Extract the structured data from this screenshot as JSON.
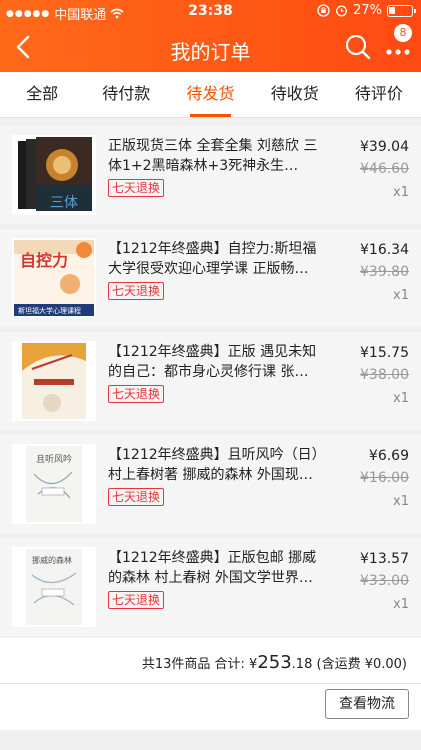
{
  "status_bar": {
    "carrier": "中国联通",
    "time": "23:38",
    "battery": "27%"
  },
  "header": {
    "title": "我的订单",
    "badge_count": "8"
  },
  "tabs": [
    {
      "label": "全部",
      "active": false
    },
    {
      "label": "待付款",
      "active": false
    },
    {
      "label": "待发货",
      "active": true
    },
    {
      "label": "待收货",
      "active": false
    },
    {
      "label": "待评价",
      "active": false
    }
  ],
  "items": [
    {
      "title": "正版现货三体 全套全集 刘慈欣 三体1+2黑暗森林+3死神永生…",
      "tag": "七天退换",
      "price": "¥39.04",
      "original_price": "¥46.60",
      "qty": "x1",
      "cover": "santi-cover"
    },
    {
      "title": "【1212年终盛典】自控力:斯坦福大学很受欢迎心理学课 正版畅…",
      "tag": "七天退换",
      "price": "¥16.34",
      "original_price": "¥39.80",
      "qty": "x1",
      "cover": "zikongli-cover",
      "cover_text": "自控力",
      "cover_subtext": "斯坦福大学心理课程"
    },
    {
      "title": "【1212年终盛典】正版 遇见未知的自己：都市身心灵修行课 张…",
      "tag": "七天退换",
      "price": "¥15.75",
      "original_price": "¥38.00",
      "qty": "x1",
      "cover": "yujian-cover"
    },
    {
      "title": "【1212年终盛典】且听风吟（日）村上春树著 挪威的森林 外国现…",
      "tag": "七天退换",
      "price": "¥6.69",
      "original_price": "¥16.00",
      "qty": "x1",
      "cover": "qietingfengyin-cover",
      "cover_text": "且听风吟"
    },
    {
      "title": "【1212年终盛典】正版包邮 挪威的森林 村上春树 外国文学世界…",
      "tag": "七天退换",
      "price": "¥13.57",
      "original_price": "¥33.00",
      "qty": "x1",
      "cover": "nuowei-cover",
      "cover_text": "挪威的森林"
    }
  ],
  "summary": {
    "count_text": "共13件商品 合计:",
    "currency": "¥",
    "total_int": "253",
    "total_dec": ".18",
    "shipping_text": "(含运费 ¥0.00)"
  },
  "footer": {
    "logistics_label": "查看物流"
  },
  "colors": {
    "brand": "#ff5000",
    "refund_tag": "#e8363b"
  }
}
